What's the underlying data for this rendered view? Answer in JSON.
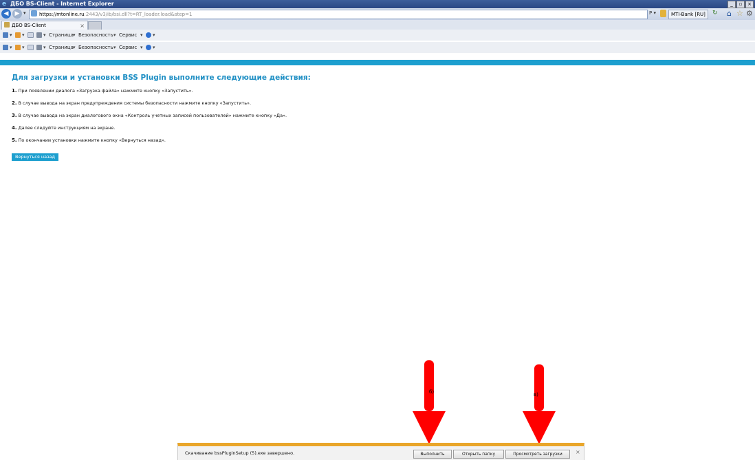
{
  "window": {
    "title": "ДБО BS-Client - Internet Explorer",
    "buttons": [
      "_",
      "▫",
      "×"
    ]
  },
  "address_bar": {
    "url_host": "https://mtonline.ru",
    "url_path": ":2443/v3/ib/bsi.dll?t=RT_loader.load&step=1",
    "tools": "P ▾",
    "certificate": "MTI-Bank [RU]",
    "refresh_glyph": "↻",
    "home_glyph": "⌂",
    "favorites_glyph": "☆",
    "tools_glyph": "⚙"
  },
  "tab": {
    "label": "ДБО BS-Client",
    "close": "×"
  },
  "command_bar": {
    "page": "Страница",
    "safety": "Безопасность",
    "service": "Сервис",
    "caret": "▾"
  },
  "content": {
    "heading": "Для загрузки и установки BSS Plugin выполните следующие действия:",
    "steps": [
      {
        "num": "1.",
        "text": "При появлении диалога «Загрузка файла» нажмите кнопку «Запустить»."
      },
      {
        "num": "2.",
        "text": "В случае вывода на экран предупреждения системы безопасности нажмите кнопку «Запустить»."
      },
      {
        "num": "3.",
        "text": "В случае вывода на экран диалогового окна «Контроль учетных записей пользователей» нажмите кнопку «Да»."
      },
      {
        "num": "4.",
        "text": "Далее следуйте инструкциям на экране."
      },
      {
        "num": "5.",
        "text": "По окончании установки нажмите кнопку «Вернуться назад»."
      }
    ],
    "back_button": "Вернуться назад"
  },
  "annotations": {
    "arrow_left_label": "б)",
    "arrow_right_label": "в)",
    "arrow_color": "#ff0000"
  },
  "download_bar": {
    "message": "Скачивание bssPluginSetup (5).exe завершено.",
    "run": "Выполнить",
    "open_folder": "Открыть папку",
    "view_downloads": "Просмотреть загрузки",
    "close": "×"
  },
  "colors": {
    "accent": "#1d9fcf",
    "heading": "#1f8fc4",
    "download_bar_border": "#e9a62a"
  }
}
